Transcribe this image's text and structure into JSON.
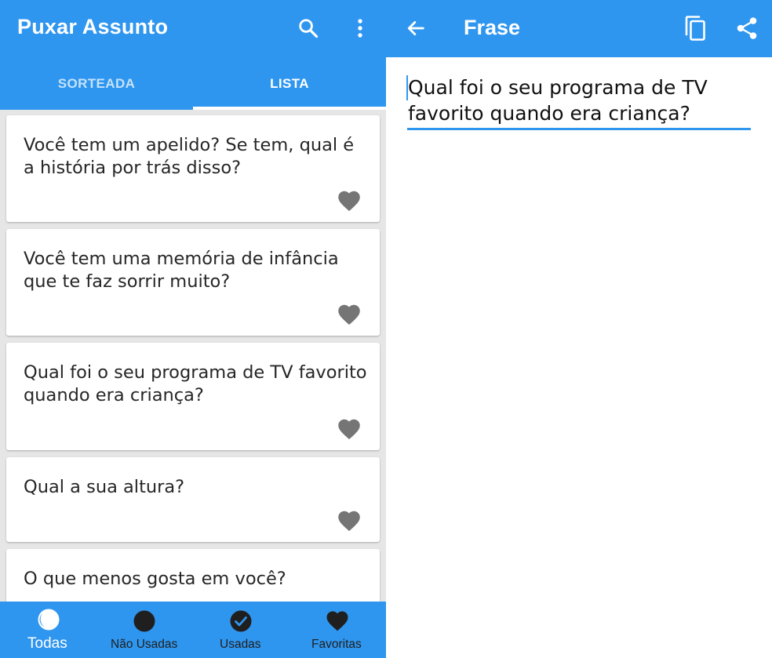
{
  "left_screen": {
    "app_title": "Puxar Assunto",
    "icons": {
      "search": "search-icon",
      "more": "more-vert-icon"
    },
    "tabs": [
      {
        "label": "SORTEADA",
        "selected": false
      },
      {
        "label": "LISTA",
        "selected": true
      }
    ],
    "cards": [
      {
        "text": "Você tem um apelido? Se tem, qual é a história por trás disso?",
        "icon": "heart-icon"
      },
      {
        "text": "Você tem uma memória de infância que te faz sorrir muito?",
        "icon": "heart-icon"
      },
      {
        "text": "Qual foi o seu programa de TV favorito quando era criança?",
        "icon": "heart-icon"
      },
      {
        "text": "Qual a sua altura?",
        "icon": "heart-icon"
      },
      {
        "text": "O que menos gosta em você?",
        "icon": "heart-icon"
      }
    ],
    "bottom_nav": [
      {
        "label": "Todas",
        "icon": "all-icon",
        "selected": true
      },
      {
        "label": "Não Usadas",
        "icon": "circle-icon",
        "selected": false
      },
      {
        "label": "Usadas",
        "icon": "check-circle-icon",
        "selected": false
      },
      {
        "label": "Favoritas",
        "icon": "heart-icon",
        "selected": false
      }
    ]
  },
  "right_screen": {
    "title": "Frase",
    "icons": {
      "back": "arrow-back-icon",
      "copy": "copy-icon",
      "share": "share-icon"
    },
    "phrase_value": "Qual foi o seu programa de TV favorito quando era criança?"
  },
  "colors": {
    "primary": "#2f96ef",
    "icon_gray": "#757575",
    "nav_icon_dark": "#1f1f1f",
    "background": "#e6e6e6"
  }
}
